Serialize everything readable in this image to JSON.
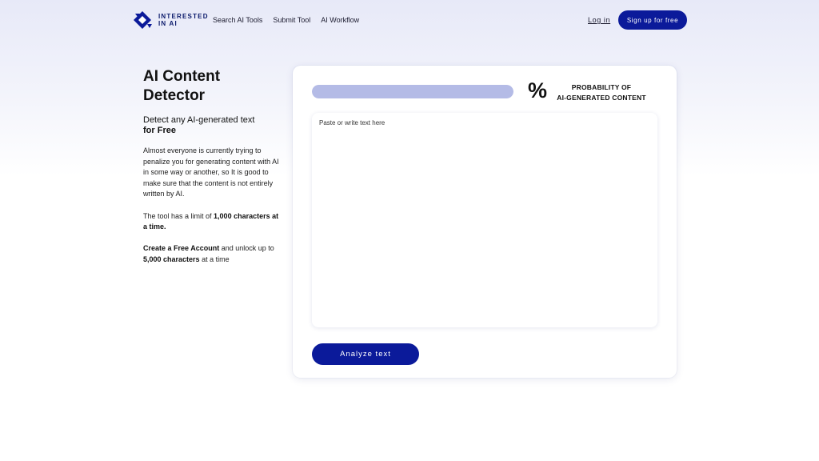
{
  "header": {
    "logo_line1": "INTERESTED",
    "logo_line2": "IN AI",
    "nav": [
      {
        "label": "Search AI Tools"
      },
      {
        "label": "Submit Tool"
      },
      {
        "label": "AI Workflow"
      }
    ],
    "login_label": "Log in",
    "signup_label": "Sign up for free"
  },
  "left": {
    "title_line1": "AI Content",
    "title_line2": "Detector",
    "subtitle": "Detect any AI-generated text",
    "subtitle_bold": "for Free",
    "para1": "Almost everyone is currently trying to penalize you for generating content with AI in some way or another, so It is good to make sure that the content is not entirely written by AI.",
    "para2_prefix": "The tool has a limit of ",
    "para2_bold": "1,000 characters at a time.",
    "para3_bold1": "Create a Free Account",
    "para3_mid": " and unlock up to ",
    "para3_bold2": "5,000 characters",
    "para3_suffix": " at a time"
  },
  "detector": {
    "progress_fraction": 1.0,
    "percent_symbol": "%",
    "prob_line1": "PROBABILITY OF",
    "prob_line2": "AI-GENERATED CONTENT",
    "input_placeholder": "Paste or write text here",
    "input_value": "",
    "analyze_label": "Analyze text"
  },
  "colors": {
    "accent": "#0b1a9a",
    "progress_fill": "#b4bbe6"
  }
}
